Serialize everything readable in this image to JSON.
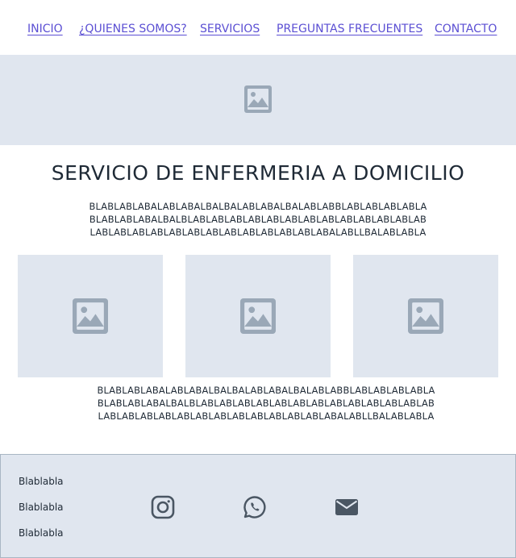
{
  "nav": {
    "items": [
      "INICIO",
      "¿QUIENES SOMOS?",
      "SERVICIOS",
      "PREGUNTAS FRECUENTES",
      "CONTACTO"
    ]
  },
  "hero": {
    "image_icon": "image-placeholder-icon"
  },
  "main": {
    "title": "SERVICIO DE ENFERMERIA A DOMICILIO",
    "intro_lines": [
      "BLABLABLABALABLABALBALBALABLABALBALABLABBLABLABLABLABLA",
      "BLABLABLABALBALBLABLABLABLABLABLABLABLABLABLABLABLABLAB",
      "LABLABLABLABLABLABLABLABLABLABLABLABLABALABLLBALABLABLA"
    ],
    "cards": [
      {
        "icon": "image-placeholder-icon"
      },
      {
        "icon": "image-placeholder-icon"
      },
      {
        "icon": "image-placeholder-icon"
      }
    ],
    "outro_lines": [
      "BLABLABLABALABLABALBALBALABLABALBALABLABBLABLABLABLABLA",
      "BLABLABLABALBALBLABLABLABLABLABLABLABLABLABLABLABLABLAB",
      "LABLABLABLABLABLABLABLABLABLABLABLABLABALABLLBALABLABLA"
    ]
  },
  "footer": {
    "links": [
      "Blablabla",
      "Blablabla",
      "Blablabla"
    ],
    "social": [
      "instagram-icon",
      "whatsapp-icon",
      "envelope-icon"
    ]
  },
  "colors": {
    "nav_link": "#5b4fd3",
    "placeholder_bg": "#e0e6ef",
    "icon": "#9aa8b7",
    "text": "#1f2a36"
  }
}
